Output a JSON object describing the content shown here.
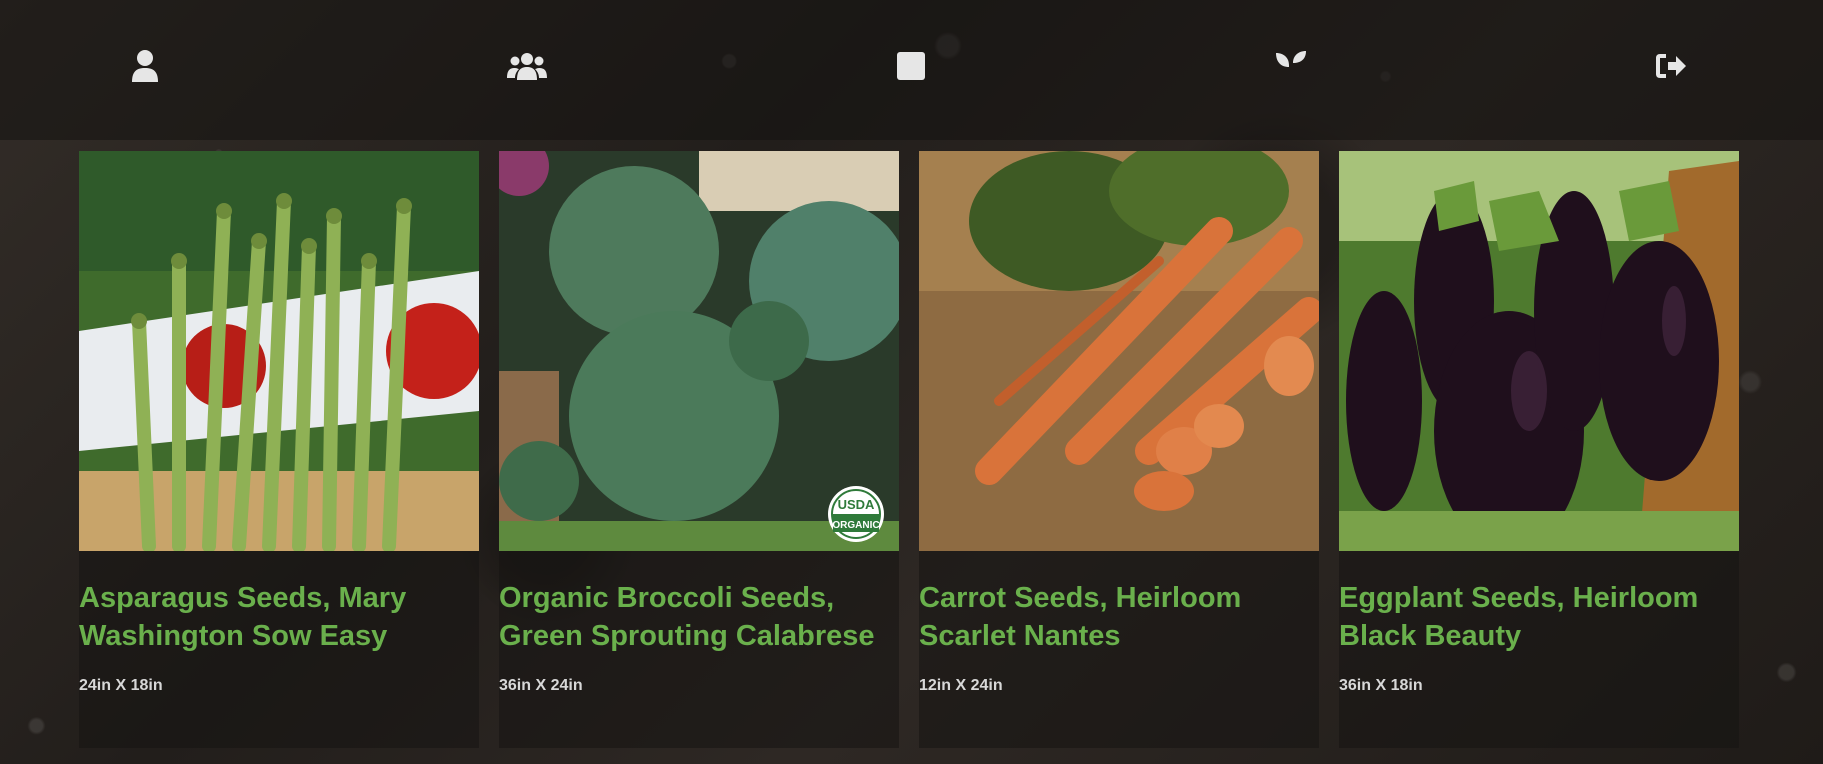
{
  "nav": {
    "items": [
      {
        "icon": "user-icon"
      },
      {
        "icon": "users-icon"
      },
      {
        "icon": "square-icon"
      },
      {
        "icon": "seedling-icon"
      },
      {
        "icon": "sign-out-icon"
      }
    ]
  },
  "products": [
    {
      "title": "Asparagus Seeds, Mary Washington Sow Easy",
      "size": "24in X 18in",
      "image": "asparagus and tomatoes photo"
    },
    {
      "title": "Organic Broccoli Seeds, Green Sprouting Calabrese",
      "size": "36in X 24in",
      "image": "broccoli photo",
      "badge_line1": "USDA",
      "badge_line2": "ORGANIC"
    },
    {
      "title": "Carrot Seeds, Heirloom Scarlet Nantes",
      "size": "12in X 24in",
      "image": "carrots photo"
    },
    {
      "title": "Eggplant Seeds, Heirloom Black Beauty",
      "size": "36in X 18in",
      "image": "eggplants photo"
    }
  ],
  "colors": {
    "title": "#6ab04c",
    "size_text": "#d8d8d8",
    "nav_icon": "#e6e6e6"
  }
}
